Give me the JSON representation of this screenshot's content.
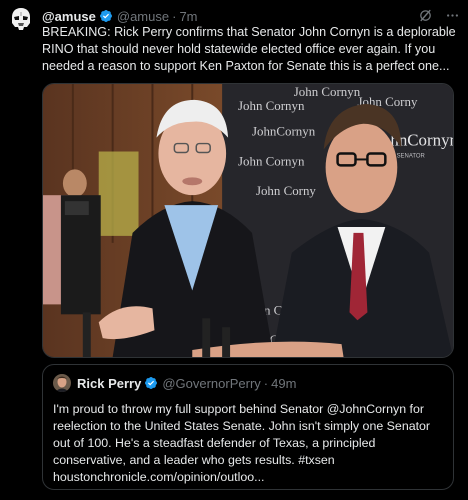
{
  "tweet": {
    "display_name": "@amuse",
    "handle": "@amuse",
    "separator": "·",
    "time": "7m",
    "text": "BREAKING: Rick Perry confirms that Senator John Cornyn is a deplorable RINO that should never hold statewide elected office ever again. If you needed a reason to support Ken Paxton for Senate this is a perfect one...",
    "avatar_icon": "stormtrooper-helmet-icon",
    "verified_color": "#1d9bf0"
  },
  "media": {
    "backdrop_words": [
      "John Cornyn",
      "John Corny",
      "JohnCornyn",
      "U.S. SENATOR"
    ]
  },
  "quote": {
    "display_name": "Rick Perry",
    "handle": "@GovernorPerry",
    "separator": "·",
    "time": "49m",
    "text": "I'm proud to throw my full support behind Senator @JohnCornyn for reelection to the United States Senate. John isn't simply one Senator out of 100. He's a steadfast defender of Texas, a principled conservative, and a leader who gets results. #txsen houstonchronicle.com/opinion/outloo..."
  }
}
